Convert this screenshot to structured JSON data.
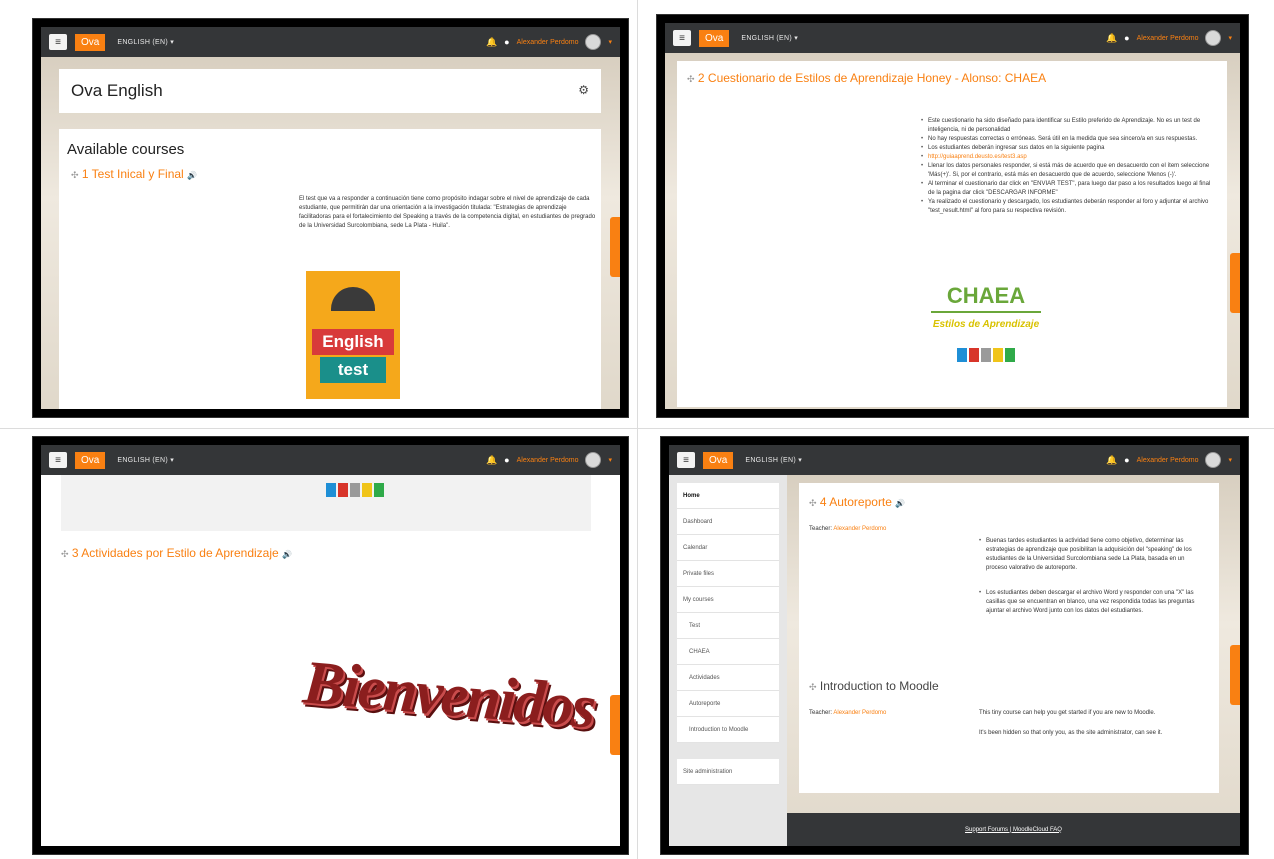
{
  "common": {
    "brand": "Ova",
    "language": "ENGLISH (EN)",
    "user_name": "Alexander Perdomo",
    "caret": "▾",
    "menu_glyph": "≡",
    "bell_glyph": "🔔",
    "chat_glyph": "●"
  },
  "panel1": {
    "page_title": "Ova English",
    "available_courses": "Available courses",
    "section_title": "1 Test Inical y Final",
    "description": "El test que va a responder a continuación tiene como propósito indagar sobre el nivel de aprendizaje de cada estudiante, que permitirán dar una orientación a la investigación titulada: \"Estrategias de aprendizaje facilitadoras para el fortalecimiento del Speaking a través de la competencia digital, en estudiantes de pregrado de la Universidad Surcolombiana, sede La Plata - Huila\".",
    "image_text_1": "English",
    "image_text_2": "test"
  },
  "panel2": {
    "section_title": "2 Cuestionario de Estilos de Aprendizaje Honey - Alonso: CHAEA",
    "bullets": [
      "Este cuestionario ha sido diseñado para identificar su Estilo preferido de Aprendizaje. No es un test de inteligencia, ni de personalidad",
      "No hay respuestas correctas o erróneas. Será útil en la medida que sea sincero/a en sus respuestas.",
      "Los estudiantes deberán ingresar sus datos en la siguiente pagina",
      "http://guiaaprend.deusto.es/test3.asp",
      "Llenar los datos personales responder, si está más de acuerdo que en desacuerdo con el ítem seleccione 'Más(+)'. Si, por el contrario, está más en desacuerdo que de acuerdo, seleccione 'Menos (-)'.",
      "Al terminar el cuestionario dar click en \"ENVIAR TEST\", para luego dar paso a los resultados luego al final de la pagina dar click \"DESCARGAR INFORME\"",
      "Ya realizado el cuestionario y descargado, los estudiantes deberán responder al foro y adjuntar el archivo \"test_result.html\" al foro para su respectiva revisión."
    ],
    "logo_title": "CHAEA",
    "logo_subtitle": "Estilos de Aprendizaje"
  },
  "panel3": {
    "section_title": "3 Actividades por Estilo de Aprendizaje",
    "welcome_art": "Bienvenidos"
  },
  "panel4": {
    "nav": {
      "home": "Home",
      "dashboard": "Dashboard",
      "calendar": "Calendar",
      "private_files": "Private files",
      "my_courses": "My courses",
      "courses": [
        "Test",
        "CHAEA",
        "Actividades",
        "Autoreporte",
        "Introduction to Moodle"
      ],
      "site_admin": "Site administration"
    },
    "section1_title": "4 Autoreporte",
    "teacher_label": "Teacher:",
    "teacher_name": "Alexander Perdomo",
    "section1_bullets": [
      "Buenas tardes estudiantes la actividad tiene como objetivo, determinar las estrategias de aprendizaje que posibilitan la adquisición del \"speaking\" de los estudiantes de la Universidad Surcolombiana sede La Plata, basada en un proceso valorativo de autoreporte.",
      "Los estudiantes deben descargar el archivo Word y responder con una \"X\" las casillas que se encuentran en blanco, una vez respondida todas las preguntas ajuntar el archivo Word junto con los datos del estudiantes."
    ],
    "section2_title": "Introduction to Moodle",
    "section2_text1": "This tiny course can help you get started if you are new to Moodle.",
    "section2_text2": "It's been hidden so that only you, as the site administrator, can see it.",
    "footer": "Support Forums | MoodleCloud FAQ"
  }
}
